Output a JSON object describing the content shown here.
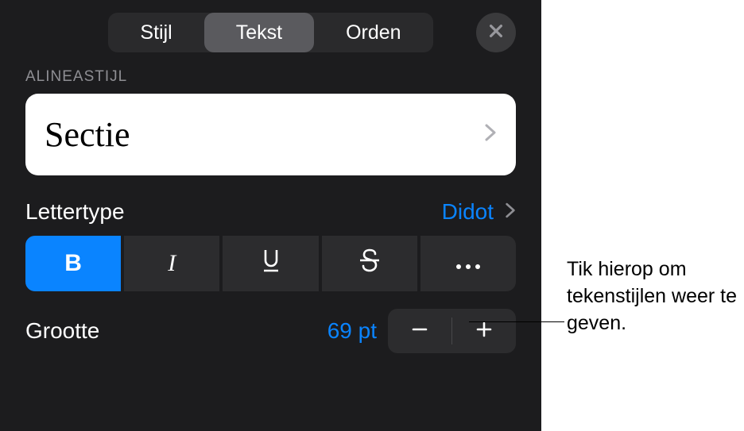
{
  "tabs": {
    "stijl": "Stijl",
    "tekst": "Tekst",
    "orden": "Orden"
  },
  "section_header": "ALINEASTIJL",
  "paragraph_style": {
    "name": "Sectie"
  },
  "font_row": {
    "label": "Lettertype",
    "value": "Didot"
  },
  "fmt": {
    "bold": "B",
    "italic": "I",
    "underline": "U",
    "strike": "S",
    "more": "more-icon"
  },
  "size_row": {
    "label": "Grootte",
    "value": "69 pt"
  },
  "callout": "Tik hierop om tekenstijlen weer te geven."
}
